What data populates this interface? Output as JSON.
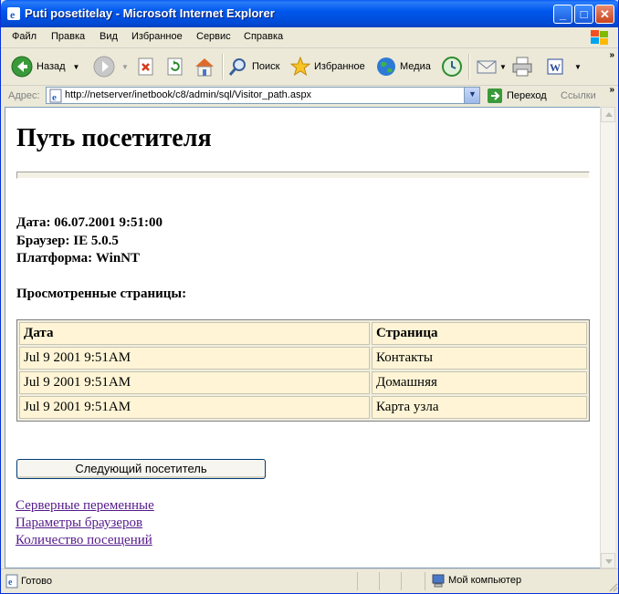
{
  "window": {
    "title": "Puti posetitelay - Microsoft Internet Explorer",
    "minimize": "_",
    "maximize": "□",
    "close": "✕"
  },
  "menu": [
    "Файл",
    "Правка",
    "Вид",
    "Избранное",
    "Сервис",
    "Справка"
  ],
  "toolbar": {
    "back": "Назад",
    "search": "Поиск",
    "favorites": "Избранное",
    "media": "Медиа",
    "overflow": "»"
  },
  "address": {
    "label": "Адрес:",
    "url": "http://netserver/inetbook/c8/admin/sql/Visitor_path.aspx",
    "go": "Переход",
    "links": "Ссылки",
    "overflow": "»"
  },
  "page": {
    "title": "Путь посетителя",
    "date_line": "Дата: 06.07.2001 9:51:00",
    "browser_line": "Браузер: IE 5.0.5",
    "platform_line": "Платформа: WinNT",
    "viewed_heading": "Просмотренные страницы:",
    "table": {
      "headers": [
        "Дата",
        "Страница"
      ],
      "rows": [
        [
          "Jul 9 2001 9:51AM",
          "Контакты"
        ],
        [
          "Jul 9 2001 9:51AM",
          "Домашняя"
        ],
        [
          "Jul 9 2001 9:51AM",
          "Карта узла"
        ]
      ]
    },
    "next_button": "Следующий посетитель",
    "links": [
      "Серверные переменные",
      "Параметры браузеров",
      "Количество посещений"
    ]
  },
  "status": {
    "text": "Готово",
    "zone": "Мой компьютер"
  },
  "colors": {
    "title_bar": "#0058ee",
    "visited_link": "#551a8b",
    "table_cell": "#fff5d6"
  }
}
